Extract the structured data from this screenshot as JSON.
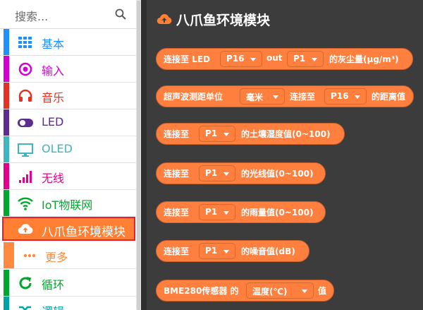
{
  "search": {
    "placeholder": "搜索..."
  },
  "categories": [
    {
      "label": "基本",
      "color": "#1e90ff",
      "icon": "grid-icon"
    },
    {
      "label": "输入",
      "color": "#d400d4",
      "icon": "target-icon"
    },
    {
      "label": "音乐",
      "color": "#e63022",
      "icon": "headphones-icon"
    },
    {
      "label": "LED",
      "color": "#5c2d91",
      "icon": "toggle-icon"
    },
    {
      "label": "OLED",
      "color": "#3fb5c0",
      "icon": "monitor-icon"
    },
    {
      "label": "无线",
      "color": "#e3008c",
      "icon": "signal-bars-icon"
    },
    {
      "label": "IoT物联网",
      "color": "#00a82d",
      "icon": "wifi-icon"
    },
    {
      "label": "八爪鱼环境模块",
      "color": "#ff7f33",
      "icon": "cloud-upload-icon"
    },
    {
      "label": "更多",
      "color": "#ff8a3d",
      "icon": "dots-icon"
    },
    {
      "label": "循环",
      "color": "#00a52d",
      "icon": "refresh-icon"
    },
    {
      "label": "逻辑",
      "color": "#00a4a6",
      "icon": "shuffle-icon"
    }
  ],
  "flyout": {
    "title": "八爪鱼环境模块",
    "blocks": [
      {
        "parts": [
          "连接至 LED",
          {
            "dd": "P16"
          },
          "out",
          {
            "dd": "P1"
          },
          "的灰尘量(μg/m³)"
        ]
      },
      {
        "parts": [
          "超声波测距单位",
          {
            "dd": "毫米"
          },
          "连接至",
          {
            "dd": "P16"
          },
          "的距离值"
        ]
      },
      {
        "parts": [
          "连接至",
          {
            "dd": "P1"
          },
          "的土壤湿度值(0~100)"
        ]
      },
      {
        "parts": [
          "连接至",
          {
            "dd": "P1"
          },
          "的光线值(0~100)"
        ]
      },
      {
        "parts": [
          "连接至",
          {
            "dd": "P1"
          },
          "的雨量值(0~100)"
        ]
      },
      {
        "parts": [
          "连接至",
          {
            "dd": "P1"
          },
          "的噪音值(dB)"
        ]
      },
      {
        "parts": [
          "BME280传感器 的",
          {
            "dd": "温度(℃)"
          },
          "值"
        ]
      }
    ]
  }
}
